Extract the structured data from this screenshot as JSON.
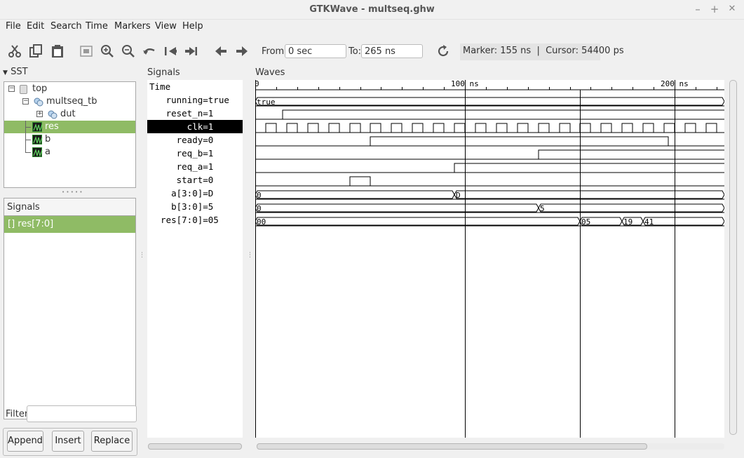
{
  "window": {
    "title": "GTKWave - multseq.ghw",
    "minimize": "–",
    "maximize": "+",
    "close": "✕"
  },
  "menu": [
    "File",
    "Edit",
    "Search",
    "Time",
    "Markers",
    "View",
    "Help"
  ],
  "toolbar": {
    "from_label": "From:",
    "from_value": "0 sec",
    "to_label": "To:",
    "to_value": "265 ns",
    "marker_text": "Marker: 155 ns  |  Cursor: 54400 ps",
    "icons": [
      "cut-icon",
      "copy-icon",
      "paste-icon",
      "zoom-fit-icon",
      "zoom-in-icon",
      "zoom-out-icon",
      "undo-zoom-icon",
      "zoom-start-icon",
      "zoom-end-icon",
      "arrow-left-icon",
      "arrow-right-icon",
      "reload-icon"
    ]
  },
  "sst": {
    "header": "SST",
    "tree": [
      {
        "label": "top",
        "level": 0,
        "icon": "module-icon"
      },
      {
        "label": "multseq_tb",
        "level": 1,
        "icon": "instance-icon"
      },
      {
        "label": "dut",
        "level": 2,
        "icon": "instance-icon"
      },
      {
        "label": "res",
        "level": 2,
        "icon": "signal-icon",
        "selected": true
      },
      {
        "label": "b",
        "level": 2,
        "icon": "signal-icon"
      },
      {
        "label": "a",
        "level": 2,
        "icon": "signal-icon"
      }
    ],
    "signals_header": "Signals",
    "signals_list": [
      "[] res[7:0]"
    ],
    "filter_label": "Filter:",
    "filter_value": "",
    "buttons": {
      "append": "Append",
      "insert": "Insert",
      "replace": "Replace"
    },
    "divider_dots": "• • • • •"
  },
  "signals_pane": {
    "header": "Signals",
    "rows": [
      {
        "name": "Time",
        "value": ""
      },
      {
        "name": "running",
        "value": "=true"
      },
      {
        "name": "reset_n",
        "value": "=1"
      },
      {
        "name": "clk",
        "value": "=1",
        "selected": true
      },
      {
        "name": "ready",
        "value": "=0"
      },
      {
        "name": "req_b",
        "value": "=1"
      },
      {
        "name": "req_a",
        "value": "=1"
      },
      {
        "name": "start",
        "value": "=0"
      },
      {
        "name": "a[3:0]",
        "value": "=D"
      },
      {
        "name": "b[3:0]",
        "value": "=5"
      },
      {
        "name": "res[7:0]",
        "value": "=05"
      }
    ]
  },
  "waves": {
    "header": "Waves",
    "time_labels": [
      {
        "t": 0,
        "label": "0"
      },
      {
        "t": 100,
        "label": "100 ns"
      },
      {
        "t": 200,
        "label": "200 ns"
      }
    ],
    "bus_labels": {
      "running": "true",
      "a": [
        "0",
        "D"
      ],
      "b": [
        "0",
        "5"
      ],
      "res": [
        "00",
        "05",
        "19",
        "41"
      ]
    },
    "marker_ns": 155,
    "cursor_ps": 54400
  }
}
